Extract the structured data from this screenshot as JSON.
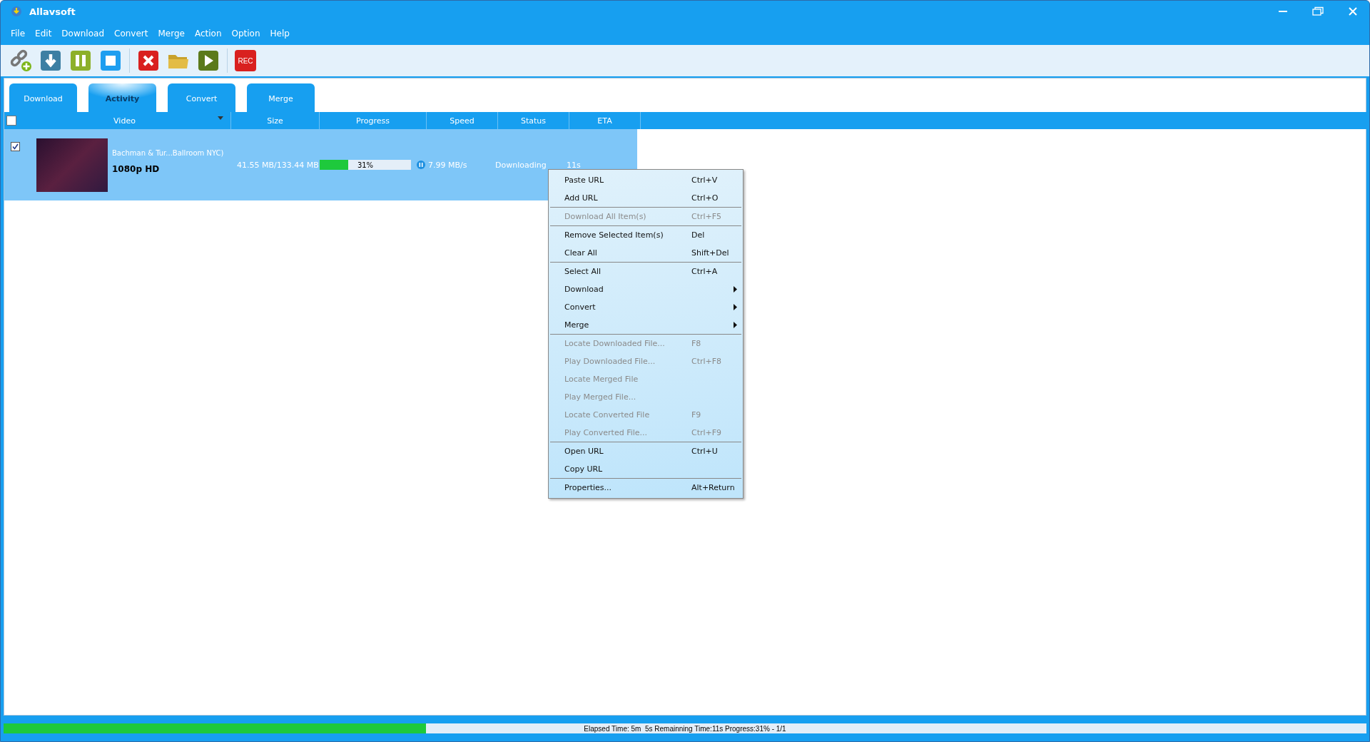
{
  "window": {
    "title": "Allavsoft"
  },
  "menu": [
    "File",
    "Edit",
    "Download",
    "Convert",
    "Merge",
    "Action",
    "Option",
    "Help"
  ],
  "toolbar": {
    "rec_label": "REC"
  },
  "tabs": [
    {
      "label": "Download",
      "selected": false
    },
    {
      "label": "Activity",
      "selected": true
    },
    {
      "label": "Convert",
      "selected": false
    },
    {
      "label": "Merge",
      "selected": false
    }
  ],
  "table": {
    "select_all_checked": false,
    "columns": [
      "Video",
      "Size",
      "Progress",
      "Speed",
      "Status",
      "ETA"
    ],
    "rows": [
      {
        "selected": true,
        "checked": true,
        "title": "Bachman & Tur...Ballroom NYC)",
        "quality": "1080p HD",
        "size": "41.55 MB/133.44 MB",
        "progress": {
          "level": 0.31,
          "text": "31%"
        },
        "speed": "7.99 MB/s",
        "status": "Downloading",
        "eta": "11s"
      }
    ]
  },
  "context_menu": {
    "groups": [
      [
        {
          "label": "Paste URL",
          "shortcut": "Ctrl+V",
          "disabled": false,
          "submenu": false
        },
        {
          "label": "Add URL",
          "shortcut": "Ctrl+O",
          "disabled": false,
          "submenu": false
        }
      ],
      [
        {
          "label": "Download All Item(s)",
          "shortcut": "Ctrl+F5",
          "disabled": true,
          "submenu": false
        }
      ],
      [
        {
          "label": "Remove Selected Item(s)",
          "shortcut": "Del",
          "disabled": false,
          "submenu": false
        },
        {
          "label": "Clear All",
          "shortcut": "Shift+Del",
          "disabled": false,
          "submenu": false
        }
      ],
      [
        {
          "label": "Select All",
          "shortcut": "Ctrl+A",
          "disabled": false,
          "submenu": false
        },
        {
          "label": "Download",
          "disabled": false,
          "submenu": true
        },
        {
          "label": "Convert",
          "disabled": false,
          "submenu": true
        },
        {
          "label": "Merge",
          "disabled": false,
          "submenu": true
        }
      ],
      [
        {
          "label": "Locate Downloaded File...",
          "shortcut": "F8",
          "disabled": true,
          "submenu": false
        },
        {
          "label": "Play Downloaded File...",
          "shortcut": "Ctrl+F8",
          "disabled": true,
          "submenu": false
        },
        {
          "label": "Locate Merged File",
          "disabled": true,
          "submenu": false
        },
        {
          "label": "Play Merged File...",
          "disabled": true,
          "submenu": false
        },
        {
          "label": "Locate Converted File",
          "shortcut": "F9",
          "disabled": true,
          "submenu": false
        },
        {
          "label": "Play Converted File...",
          "shortcut": "Ctrl+F9",
          "disabled": true,
          "submenu": false
        }
      ],
      [
        {
          "label": "Open URL",
          "shortcut": "Ctrl+U",
          "disabled": false,
          "submenu": false
        },
        {
          "label": "Copy URL",
          "disabled": false,
          "submenu": false
        }
      ],
      [
        {
          "label": "Properties...",
          "shortcut": "Alt+Return",
          "disabled": false,
          "submenu": false
        }
      ]
    ]
  },
  "status_bar": {
    "level": 0.31,
    "text": "Elapsed Time: 5m  5s Remainning Time:11s Progress:31% - 1/1"
  }
}
